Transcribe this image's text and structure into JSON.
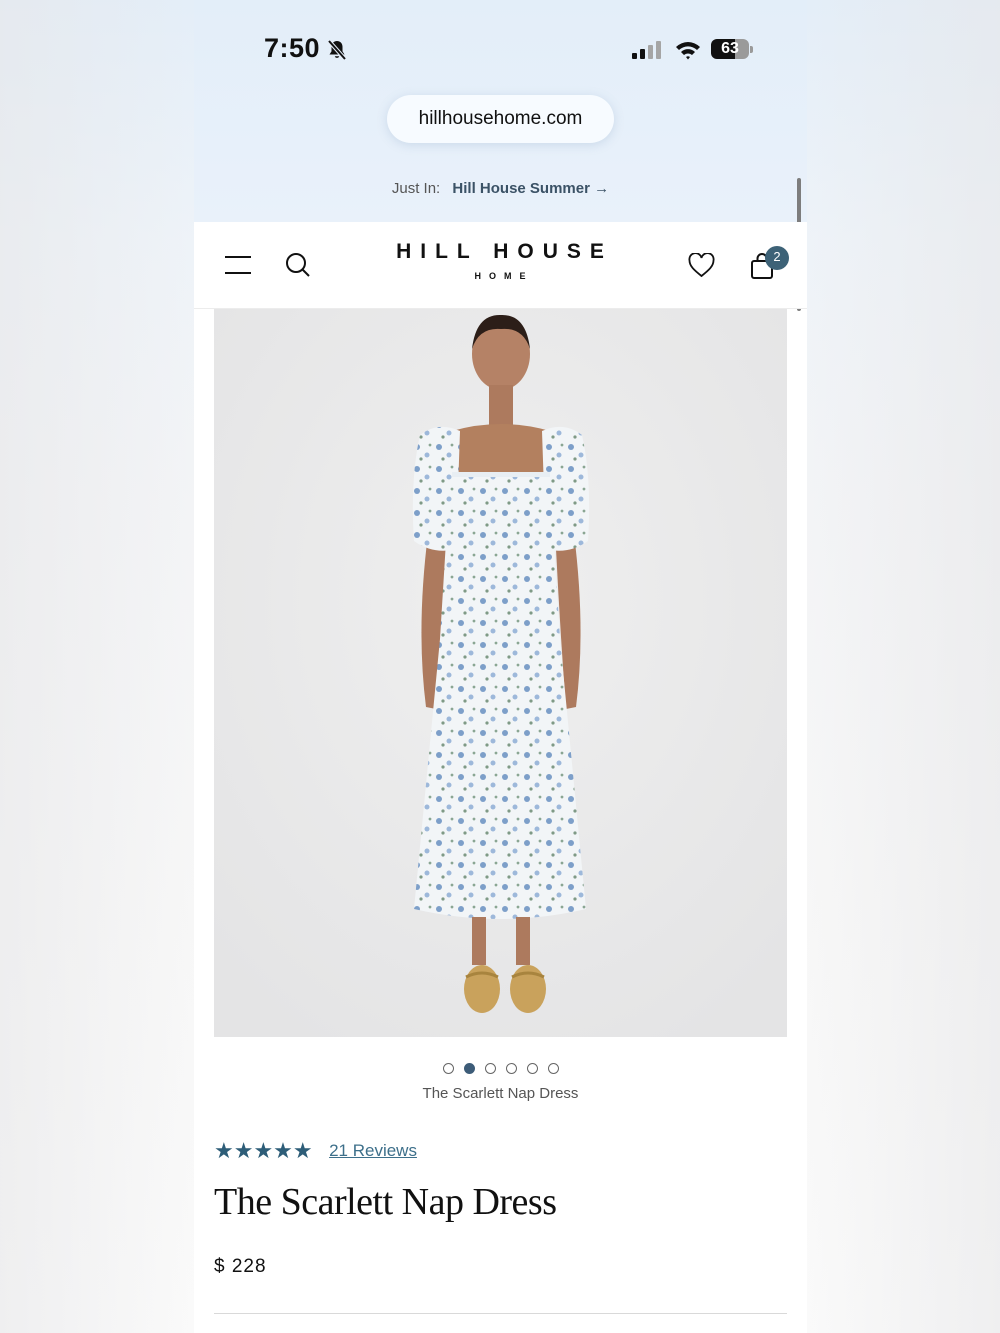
{
  "status_bar": {
    "time": "7:50",
    "battery": "63",
    "icons": [
      "bell-off-icon",
      "signal-icon",
      "wifi-icon",
      "battery-icon"
    ]
  },
  "browser": {
    "url": "hillhousehome.com"
  },
  "promo": {
    "prefix": "Just In:",
    "link": "Hill House Summer →"
  },
  "nav": {
    "logo_main": "HILL HOUSE",
    "logo_sub": "HOME",
    "cart_count": "2",
    "icons": [
      "menu-icon",
      "search-icon",
      "heart-icon",
      "bag-icon"
    ]
  },
  "product": {
    "image_caption": "The Scarlett Nap Dress",
    "carousel": {
      "total": 6,
      "active_index": 2
    },
    "rating": {
      "stars": 5,
      "reviews": "21 Reviews"
    },
    "title": "The Scarlett Nap Dress",
    "price": "$ 228"
  },
  "colors": {
    "accent": "#2d5d78",
    "badge": "#3d6277"
  }
}
